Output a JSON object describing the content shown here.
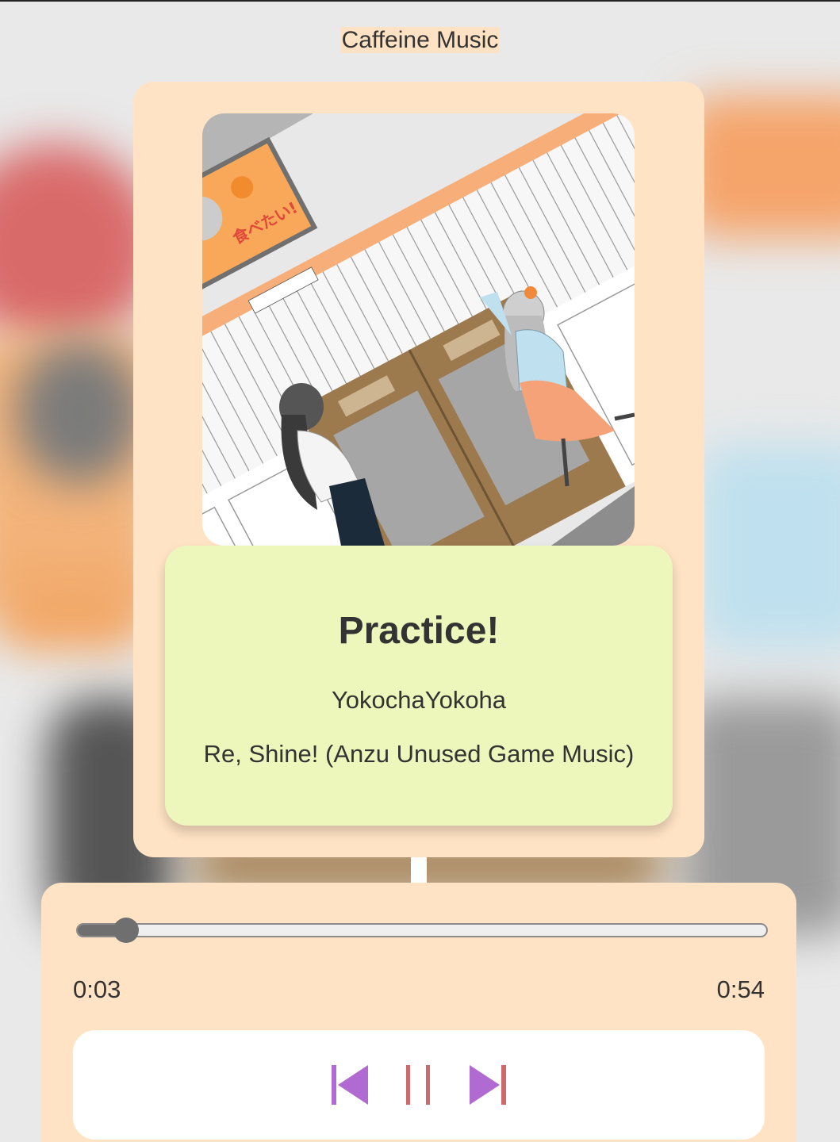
{
  "app": {
    "title": "Caffeine Music"
  },
  "track": {
    "title": "Practice!",
    "artist": "YokochaYokoha",
    "album": "Re, Shine! (Anzu Unused Game Music)"
  },
  "playback": {
    "current_time": "0:03",
    "duration": "0:54",
    "progress": 0.07,
    "state": "playing"
  },
  "controls": {
    "previous_icon": "skip-previous-icon",
    "pause_icon": "pause-icon",
    "next_icon": "skip-next-icon"
  },
  "colors": {
    "card_bg": "#ffe3c4",
    "info_bg": "#edf6bb",
    "icon_purple": "#b06ad1",
    "icon_red": "#cc6b6b",
    "slider": "#6f6f6f"
  }
}
